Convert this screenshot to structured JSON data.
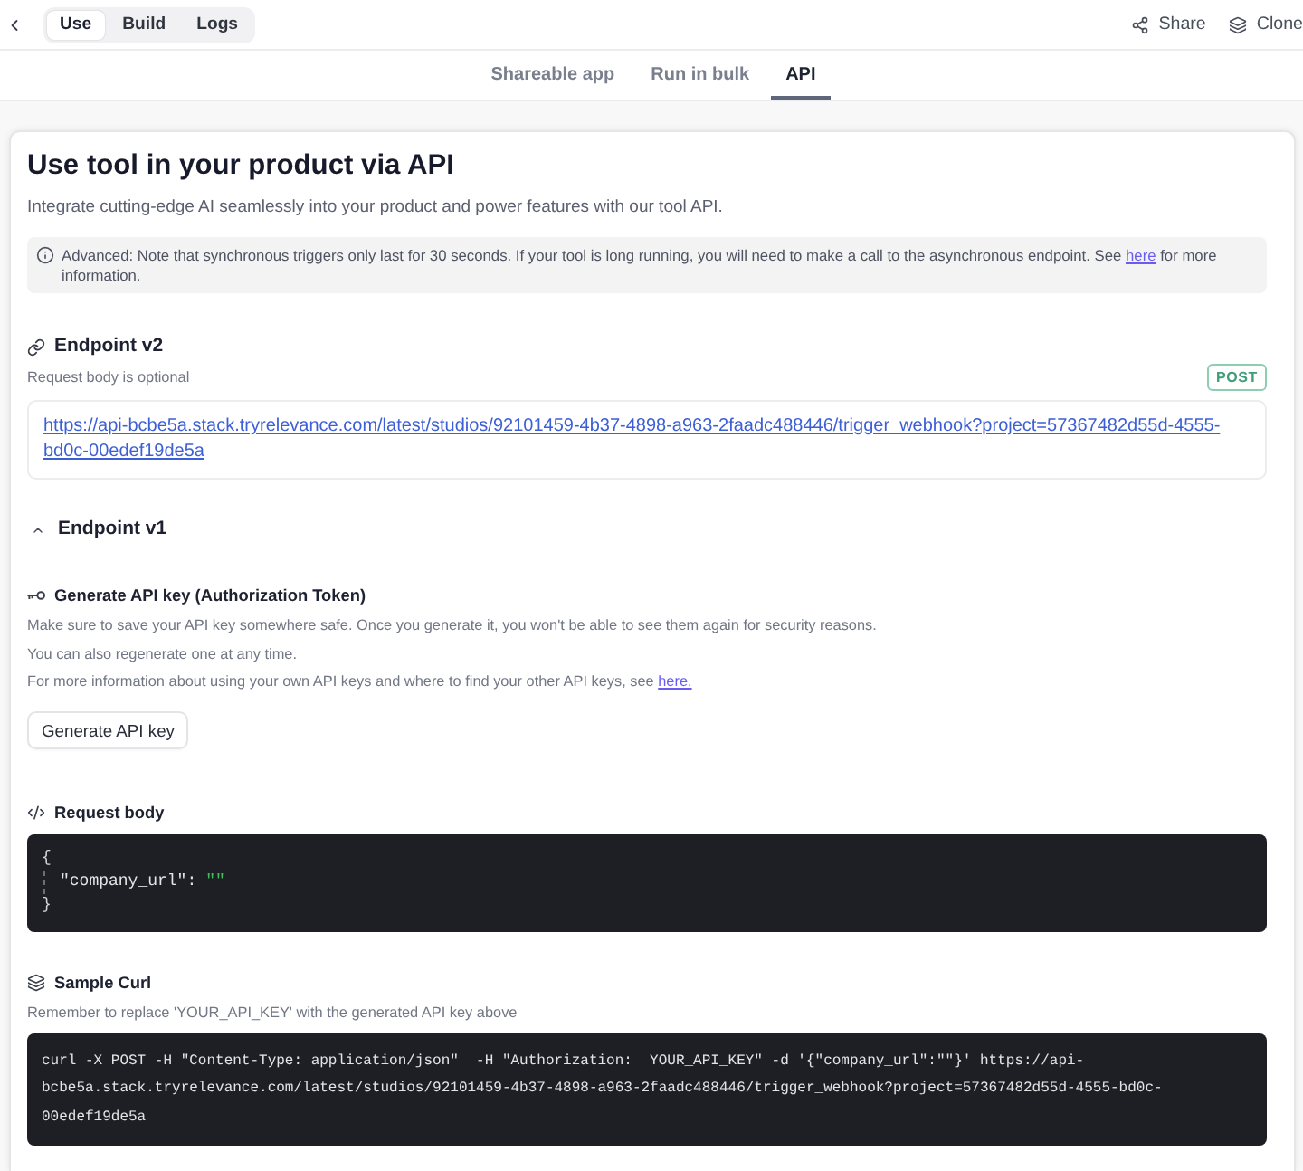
{
  "mode_tabs": [
    {
      "label": "Use",
      "selected": true
    },
    {
      "label": "Build",
      "selected": false
    },
    {
      "label": "Logs",
      "selected": false
    }
  ],
  "actions": [
    {
      "kind": "share",
      "label": "Share"
    },
    {
      "kind": "clone",
      "label": "Clone"
    }
  ],
  "view_tabs": [
    {
      "label": "Shareable app",
      "selected": false
    },
    {
      "label": "Run in bulk",
      "selected": false
    },
    {
      "label": "API",
      "selected": true
    }
  ],
  "api_panel": {
    "title": "Use tool in your product via API",
    "subtitle": "Integrate cutting-edge AI seamlessly into your product and power features with our tool API.",
    "notice": {
      "text_before": "Advanced: Note that synchronous triggers only last for 30 seconds. If your tool is long running, you will need to make a call to the asynchronous endpoint. See ",
      "link": "here",
      "text_after": " for more information."
    }
  },
  "endpoint_v2": {
    "heading": "Endpoint v2",
    "note": "Request body is optional",
    "method": "POST",
    "url": "https://api-bcbe5a.stack.tryrelevance.com/latest/studios/92101459-4b37-4898-a963-2faadc488446/trigger_webhook?project=57367482d55d-4555-bd0c-00edef19de5a"
  },
  "endpoint_v1": {
    "heading": "Endpoint v1",
    "expanded": true,
    "api_key": {
      "heading": "Generate API key (Authorization Token)",
      "lines": [
        {
          "text": "Make sure to save your API key somewhere safe. Once you generate it, you won't be able to see them again for security reasons."
        },
        {
          "text": "You can also regenerate one at any time."
        },
        {
          "text": "For more information about using your own API keys and where to find your other API keys, see ",
          "link": "here."
        }
      ],
      "button": "Generate API key"
    },
    "request_body": {
      "heading": "Request body",
      "open": "{",
      "fields": [
        {
          "key": "\"company_url\":",
          "value": "\"\""
        }
      ],
      "close": "}"
    },
    "sample_curl": {
      "heading": "Sample Curl",
      "note": "Remember to replace 'YOUR_API_KEY' with the generated API key above",
      "command": "curl -X POST -H \"Content-Type: application/json\"  -H \"Authorization:  YOUR_API_KEY\" -d '{\"company_url\":\"\"}' https://api-bcbe5a.stack.tryrelevance.com/latest/studios/92101459-4b37-4898-a963-2faadc488446/trigger_webhook?project=57367482d55d-4555-bd0c-00edef19de5a"
    }
  }
}
